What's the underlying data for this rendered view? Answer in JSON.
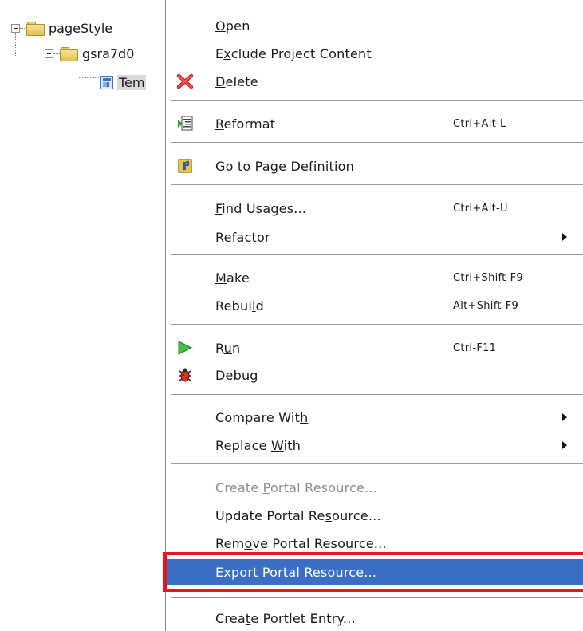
{
  "tree": {
    "root": {
      "label": "pageStyle",
      "icon": "folder-icon"
    },
    "child": {
      "label": "gsra7d0",
      "icon": "folder-icon"
    },
    "leaf": {
      "label": "Tem",
      "icon": "page-template-icon"
    }
  },
  "menu": {
    "items": [
      {
        "label": "Open",
        "u": 0
      },
      {
        "label": "Exclude Project Content",
        "u": 1
      },
      {
        "label": "Delete",
        "u": 0,
        "icon": "delete-x-icon"
      },
      {
        "label": "Reformat",
        "u": 0,
        "shortcut": "Ctrl+Alt-L",
        "icon": "reformat-icon"
      },
      {
        "label": "Go to Page Definition",
        "u": 7,
        "icon": "page-definition-icon"
      },
      {
        "label": "Find Usages...",
        "u": 0,
        "shortcut": "Ctrl+Alt-U"
      },
      {
        "label": "Refactor",
        "u": 4,
        "submenu": true
      },
      {
        "label": "Make",
        "u": 0,
        "shortcut": "Ctrl+Shift-F9"
      },
      {
        "label": "Rebuild",
        "u": 5,
        "shortcut": "Alt+Shift-F9"
      },
      {
        "label": "Run",
        "u": 1,
        "shortcut": "Ctrl-F11",
        "icon": "run-icon"
      },
      {
        "label": "Debug",
        "u": 2,
        "icon": "debug-bug-icon"
      },
      {
        "label": "Compare With",
        "u": 11,
        "submenu": true
      },
      {
        "label": "Replace With",
        "u": 8,
        "submenu": true
      },
      {
        "label": "Create Portal Resource...",
        "u": 7,
        "disabled": true
      },
      {
        "label": "Update Portal Resource...",
        "u": 16
      },
      {
        "label": "Remove Portal Resource...",
        "u": 3
      },
      {
        "label": "Export Portal Resource...",
        "u": 0,
        "selected": true
      },
      {
        "label": "Create Portlet Entry...",
        "u": 4
      }
    ]
  },
  "colors": {
    "selection": "#3b6fc6",
    "highlight_box": "#e8141a"
  }
}
